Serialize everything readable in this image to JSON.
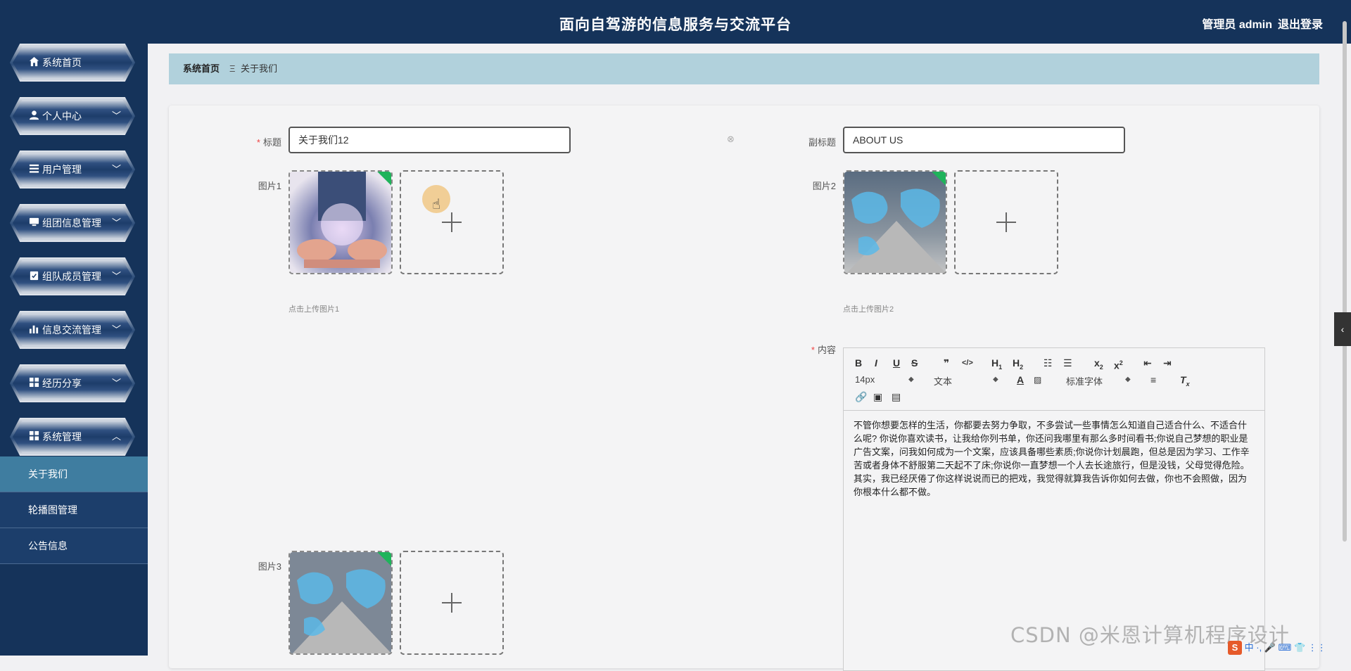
{
  "header": {
    "title": "面向自驾游的信息服务与交流平台",
    "user": "管理员 admin",
    "logout": "退出登录"
  },
  "sidebar": {
    "items": [
      {
        "label": "系统首页",
        "icon": "home-icon"
      },
      {
        "label": "个人中心",
        "icon": "user-icon"
      },
      {
        "label": "用户管理",
        "icon": "list-icon"
      },
      {
        "label": "组团信息管理",
        "icon": "monitor-icon"
      },
      {
        "label": "组队成员管理",
        "icon": "clipboard-icon"
      },
      {
        "label": "信息交流管理",
        "icon": "bar-chart-icon"
      },
      {
        "label": "经历分享",
        "icon": "grid-icon"
      },
      {
        "label": "系统管理",
        "icon": "grid-icon"
      }
    ],
    "submenu": [
      {
        "label": "关于我们",
        "active": true
      },
      {
        "label": "轮播图管理",
        "active": false
      },
      {
        "label": "公告信息",
        "active": false
      }
    ]
  },
  "breadcrumb": {
    "home": "系统首页",
    "separator": "Ξ",
    "current": "关于我们"
  },
  "form": {
    "title_label": "标题",
    "title_value": "关于我们12",
    "subtitle_label": "副标题",
    "subtitle_value": "ABOUT US",
    "pic1_label": "图片1",
    "pic1_hint": "点击上传图片1",
    "pic2_label": "图片2",
    "pic2_hint": "点击上传图片2",
    "pic3_label": "图片3",
    "content_label": "内容"
  },
  "editor": {
    "font_size": "14px",
    "paragraph": "文本",
    "font_family": "标准字体",
    "content": "不管你想要怎样的生活，你都要去努力争取，不多尝试一些事情怎么知道自己适合什么、不适合什么呢? 你说你喜欢读书，让我给你列书单，你还问我哪里有那么多时间看书;你说自己梦想的职业是广告文案，问我如何成为一个文案，应该具备哪些素质;你说你计划晨跑，但总是因为学习、工作辛苦或者身体不舒服第二天起不了床;你说你一直梦想一个人去长途旅行，但是没钱，父母觉得危险。其实，我已经厌倦了你这样说说而已的把戏，我觉得就算我告诉你如何去做，你也不会照做，因为你根本什么都不做。"
  },
  "watermark": "CSDN @米恩计算机程序设计",
  "ime": "中 ·, 🎤 ⌨ 👕 ⋮⋮"
}
